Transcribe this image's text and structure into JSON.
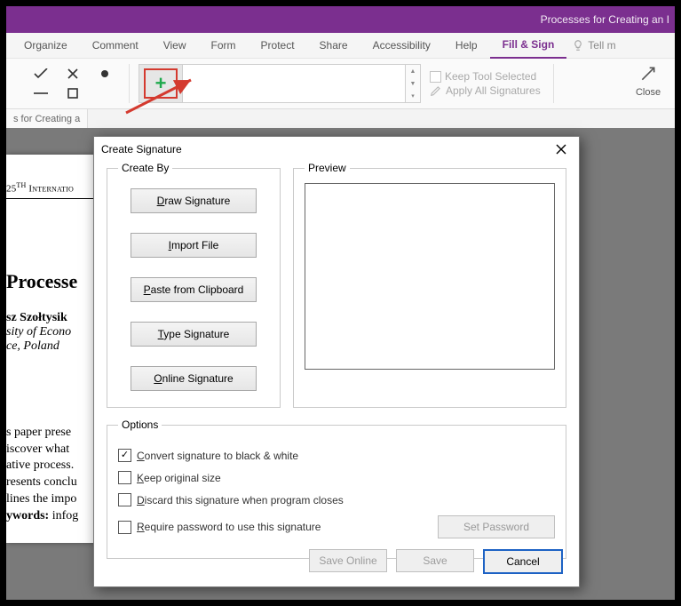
{
  "title": "Processes for Creating an I",
  "menu": {
    "organize": "Organize",
    "comment": "Comment",
    "view": "View",
    "form": "Form",
    "protect": "Protect",
    "share": "Share",
    "accessibility": "Accessibility",
    "help": "Help",
    "fillsign": "Fill & Sign",
    "tell": "Tell m"
  },
  "ribbon": {
    "keep_tool": "Keep Tool Selected",
    "apply_all": "Apply All Signatures",
    "close": "Close"
  },
  "tabstrip": {
    "tab1": "s for Creating a"
  },
  "doc": {
    "header_prefix": "25",
    "header_sup": "TH",
    "header_rest": " Internatio",
    "h1": "Processe",
    "author": "sz Szołtysik",
    "aff1": "sity of Econo",
    "aff2": "ce, Poland",
    "p1": "s paper prese",
    "p2": "iscover what ",
    "p3": "ative process.",
    "p4": "resents conclu",
    "p5": "lines the impo",
    "p6a": "ywords:",
    "p6b": " infog"
  },
  "dialog": {
    "title": "Create Signature",
    "createby_legend": "Create By",
    "preview_legend": "Preview",
    "options_legend": "Options",
    "btn_draw_pre": "D",
    "btn_draw_rest": "raw Signature",
    "btn_import_pre": "I",
    "btn_import_rest": "mport File",
    "btn_paste_pre": "P",
    "btn_paste_rest": "aste from Clipboard",
    "btn_type_pre": "T",
    "btn_type_rest": "ype Signature",
    "btn_online_pre": "O",
    "btn_online_rest": "nline Signature",
    "opt_convert_pre": "C",
    "opt_convert_rest": "onvert signature to black & white",
    "opt_keep_pre": "K",
    "opt_keep_rest": "eep original size",
    "opt_discard_pre": "D",
    "opt_discard_rest": "iscard this signature when program closes",
    "opt_require_pre": "R",
    "opt_require_rest": "equire password to use this signature",
    "set_password": "Set Password",
    "save_online": "Save Online",
    "save": "Save",
    "cancel": "Cancel"
  }
}
